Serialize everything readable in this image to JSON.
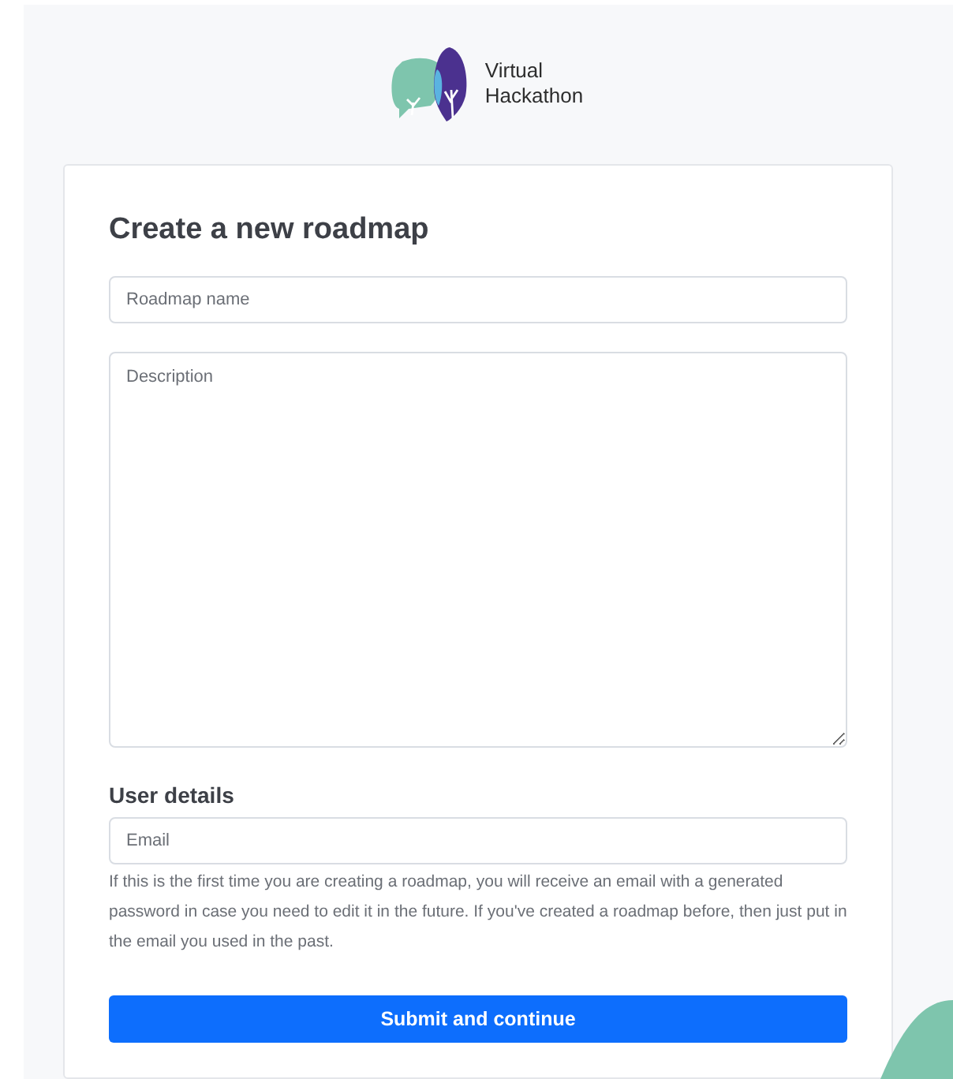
{
  "brand": {
    "name_line_1": "Virtual",
    "name_line_2": "Hackathon"
  },
  "form": {
    "title": "Create a new roadmap",
    "name_field": {
      "placeholder": "Roadmap name"
    },
    "description_field": {
      "placeholder": "Description"
    },
    "section_title": "User details",
    "email_field": {
      "placeholder": "Email"
    },
    "help_text": "If this is the first time you are creating a roadmap, you will receive an email with a generated password in case you need to edit it in the future. If you've created a roadmap before, then just put in the email you used in the past.",
    "submit_button": "Submit and continue"
  }
}
